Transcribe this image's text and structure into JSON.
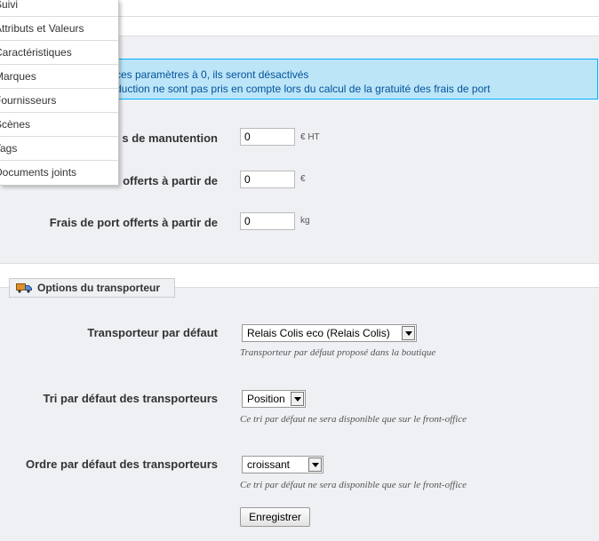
{
  "menu": {
    "items": [
      {
        "label": "Suivi"
      },
      {
        "label": "Attributs et Valeurs"
      },
      {
        "label": "Caractéristiques"
      },
      {
        "label": "Marques"
      },
      {
        "label": "Fournisseurs"
      },
      {
        "label": "Scènes"
      },
      {
        "label": "Tags"
      },
      {
        "label": "Documents joints"
      }
    ]
  },
  "info": {
    "line1": "ces paramètres à 0, ils seront désactivés",
    "line2": "duction ne sont pas pris en compte lors du calcul de la gratuité des frais de port"
  },
  "fees": {
    "handling": {
      "label": "s de manutention",
      "value": "0",
      "unit": "€ HT"
    },
    "free_price": {
      "label": "offerts à partir de",
      "value": "0",
      "unit": "€"
    },
    "free_weight": {
      "label": "Frais de port offerts à partir de",
      "value": "0",
      "unit": "kg"
    }
  },
  "carrier_options": {
    "legend": "Options du transporteur",
    "default_carrier": {
      "label": "Transporteur par défaut",
      "value": "Relais Colis eco (Relais Colis)",
      "hint": "Transporteur par défaut proposé dans la boutique"
    },
    "sort_by": {
      "label": "Tri par défaut des transporteurs",
      "value": "Position",
      "hint": "Ce tri par défaut ne sera disponible que sur le front-office"
    },
    "sort_order": {
      "label": "Ordre par défaut des transporteurs",
      "value": "croissant",
      "hint": "Ce tri par défaut ne sera disponible que sur le front-office"
    },
    "save_label": "Enregistrer"
  },
  "colors": {
    "info_bg": "#bde5f8",
    "info_border": "#00aeff",
    "info_text": "#00529b",
    "panel_bg": "#eef0f4"
  }
}
